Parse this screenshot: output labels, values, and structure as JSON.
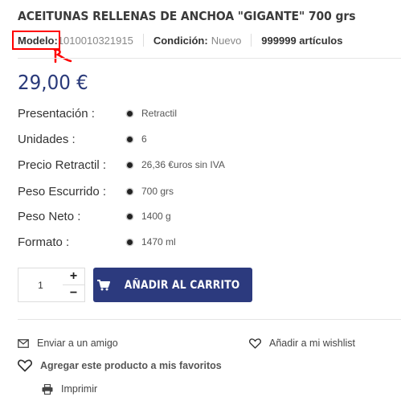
{
  "product": {
    "title": "ACEITUNAS RELLENAS DE ANCHOA \"GIGANTE\" 700 grs",
    "model_label": "Modelo:",
    "model_value": "1010010321915",
    "condition_label": "Condición:",
    "condition_value": "Nuevo",
    "stock": "999999 artículos",
    "price": "29,00 €"
  },
  "attributes": [
    {
      "label": "Presentación :",
      "value": "Retractil"
    },
    {
      "label": "Unidades :",
      "value": "6"
    },
    {
      "label": "Precio Retractil :",
      "value": "26,36 €uros sin IVA"
    },
    {
      "label": "Peso Escurrido :",
      "value": "700 grs"
    },
    {
      "label": "Peso Neto :",
      "value": "1400 g"
    },
    {
      "label": "Formato :",
      "value": "1470 ml"
    }
  ],
  "cart": {
    "quantity": "1",
    "plus": "+",
    "minus": "−",
    "add_label": "AÑADIR AL CARRITO"
  },
  "links": {
    "send_friend": "Enviar a un amigo",
    "wishlist": "Añadir a mi wishlist",
    "favorites": "Agregar este producto a mis favoritos",
    "print": "Imprimir"
  },
  "colors": {
    "accent": "#2c3a7e",
    "price": "#2a3a7a",
    "annotation": "#ff0000"
  }
}
